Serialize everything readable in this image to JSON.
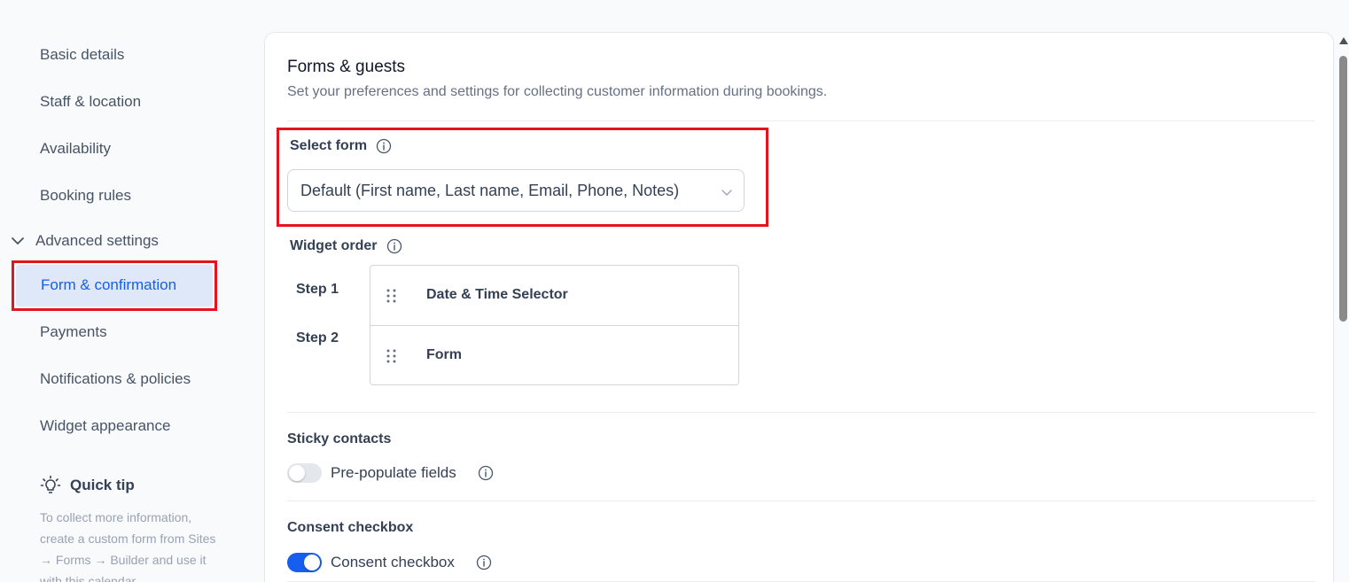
{
  "sidebar": {
    "items": [
      {
        "label": "Basic details"
      },
      {
        "label": "Staff & location"
      },
      {
        "label": "Availability"
      },
      {
        "label": "Booking rules"
      }
    ],
    "group_label": "Advanced settings",
    "active_item": "Form & confirmation",
    "sub_items": [
      {
        "label": "Payments"
      },
      {
        "label": "Notifications & policies"
      },
      {
        "label": "Widget appearance"
      }
    ],
    "tip_title": "Quick tip",
    "tip_text": "To collect more information, create a custom form from Sites → Forms → Builder and use it with this calendar."
  },
  "main": {
    "title": "Forms & guests",
    "subtitle": "Set your preferences and settings for collecting customer information during bookings.",
    "select_form_label": "Select form",
    "select_form_value": "Default (First name, Last name, Email, Phone, Notes)",
    "widget_order_label": "Widget order",
    "steps": [
      {
        "step": "Step 1",
        "widget": "Date & Time Selector"
      },
      {
        "step": "Step 2",
        "widget": "Form"
      }
    ],
    "sticky_contacts_title": "Sticky contacts",
    "prepopulate_label": "Pre-populate fields",
    "prepopulate_enabled": false,
    "consent_title": "Consent checkbox",
    "consent_label": "Consent checkbox",
    "consent_enabled": true
  },
  "colors": {
    "accent": "#155eef",
    "highlight": "#e5141c",
    "active_bg": "#dfe8f8"
  }
}
